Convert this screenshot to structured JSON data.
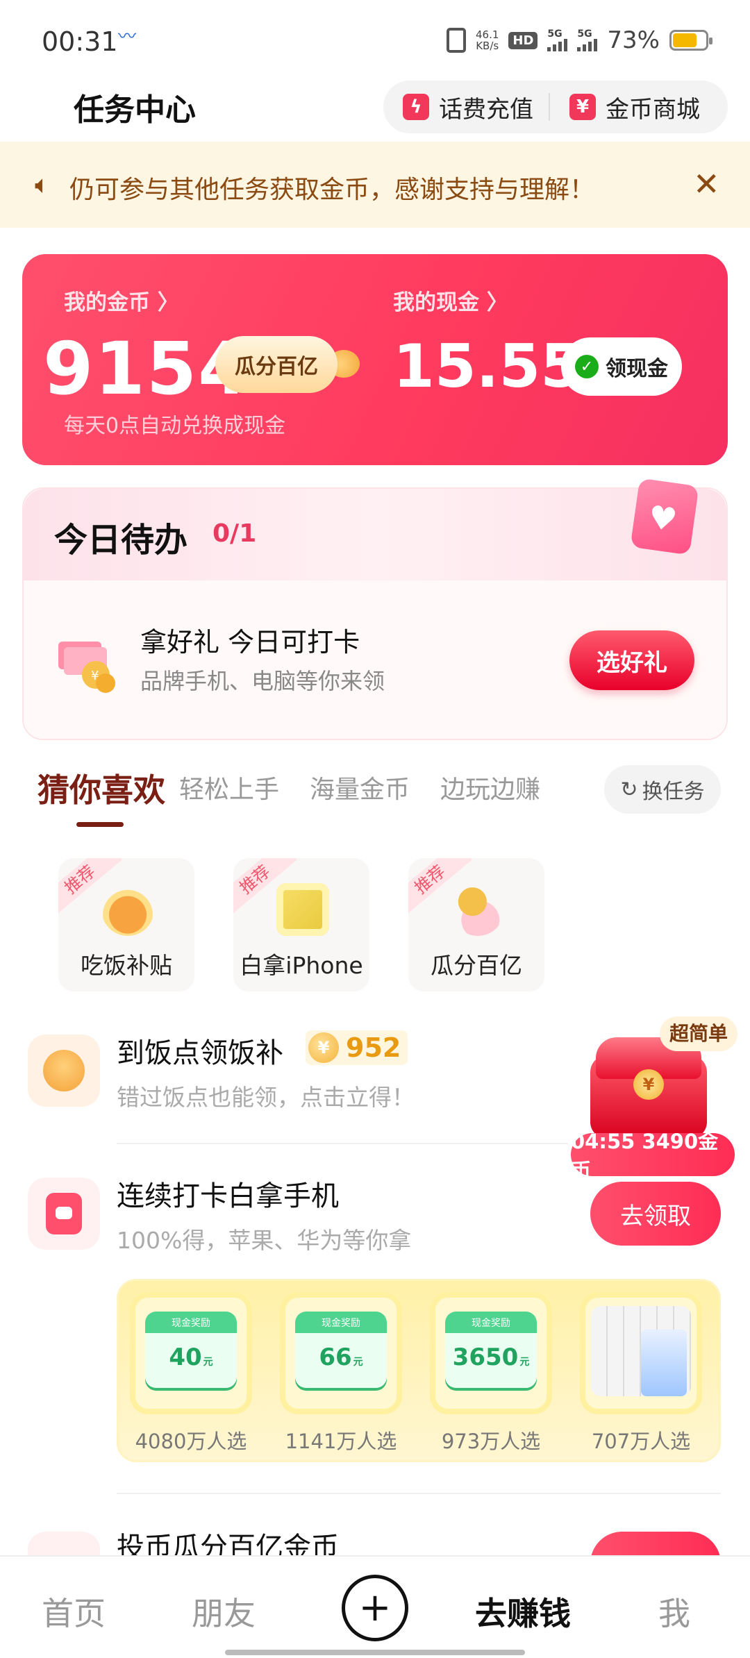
{
  "status": {
    "time": "00:31",
    "speed": "46.1",
    "speed_unit": "KB/s",
    "hd": "HD",
    "sim1": "5G",
    "sim2": "5G",
    "battery": "73%"
  },
  "header": {
    "title": "任务中心",
    "recharge": "话费充值",
    "mall": "金币商城"
  },
  "notice": {
    "text": "仍可参与其他任务获取金币，感谢支持与理解！",
    "close": "✕"
  },
  "wallet": {
    "coins_label": "我的金币 〉",
    "coins": "9154",
    "split": "瓜分百亿",
    "cash_label": "我的现金 〉",
    "cash": "15.55",
    "get_cash": "领现金",
    "hint": "每天0点自动兑换成现金"
  },
  "today": {
    "title": "今日待办",
    "count": "0/1",
    "gift_title": "拿好礼 今日可打卡",
    "gift_sub": "品牌手机、电脑等你来领",
    "button": "选好礼"
  },
  "tabs": {
    "items": [
      "猜你喜欢",
      "轻松上手",
      "海量金币",
      "边玩边赚"
    ],
    "active": 0,
    "swap": "换任务"
  },
  "recommend": [
    {
      "tag": "推荐",
      "label": "吃饭补贴"
    },
    {
      "tag": "推荐",
      "label": "白拿iPhone"
    },
    {
      "tag": "推荐",
      "label": "瓜分百亿"
    }
  ],
  "tasks": [
    {
      "title": "到饭点领饭补",
      "reward": "952",
      "sub": "错过饭点也能领，点击立得！",
      "tag": "超简单",
      "timer": "04:55 3490金币"
    },
    {
      "title": "连续打卡白拿手机",
      "sub": "100%得，苹果、华为等你拿",
      "button": "去领取"
    },
    {
      "title": "投币瓜分百亿金币"
    }
  ],
  "prizes": [
    {
      "kind": "cash",
      "card_title": "现金奖励",
      "value": "40",
      "unit": "元",
      "label": "4080万人选"
    },
    {
      "kind": "cash",
      "card_title": "现金奖励",
      "value": "66",
      "unit": "元",
      "label": "1141万人选"
    },
    {
      "kind": "cash",
      "card_title": "现金奖励",
      "value": "3650",
      "unit": "元",
      "label": "973万人选"
    },
    {
      "kind": "tissue",
      "label": "707万人选"
    }
  ],
  "nav": {
    "items": [
      "首页",
      "朋友",
      "去赚钱",
      "我"
    ],
    "active": "去赚钱",
    "plus": "+"
  },
  "colors": {
    "accent": "#ff3a5e",
    "notice_bg": "#fdf6e3",
    "tab_active": "#7a1f14"
  }
}
